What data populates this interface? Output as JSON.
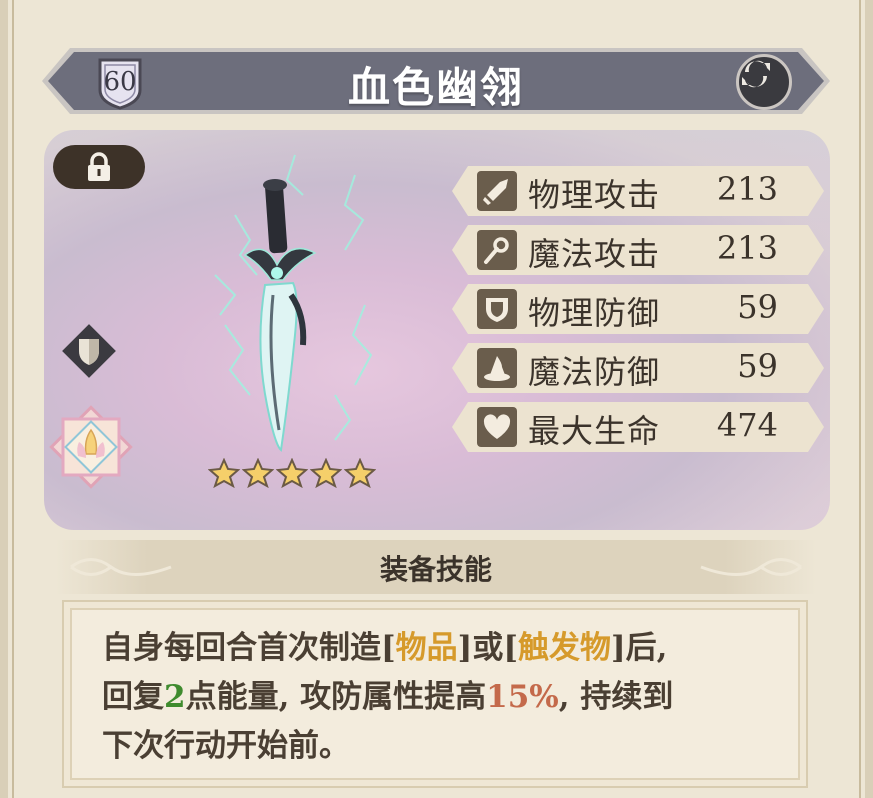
{
  "item": {
    "level": "60",
    "name": "血色幽翎",
    "stars": 5
  },
  "stats": [
    {
      "icon": "sword-icon",
      "label": "物理攻击",
      "value": "213"
    },
    {
      "icon": "staff-icon",
      "label": "魔法攻击",
      "value": "213"
    },
    {
      "icon": "shield-icon",
      "label": "物理防御",
      "value": "59"
    },
    {
      "icon": "wizard-hat-icon",
      "label": "魔法防御",
      "value": "59"
    },
    {
      "icon": "heart-icon",
      "label": "最大生命",
      "value": "474"
    }
  ],
  "skill": {
    "heading": "装备技能",
    "line1_a": "自身每回合首次制造[",
    "line1_b": "物品",
    "line1_c": "]或[",
    "line1_d": "触发物",
    "line1_e": "]后,",
    "line2_a": "回复",
    "line2_b": "2",
    "line2_c": "点能量, 攻防属性提高",
    "line2_d": "15%",
    "line2_e": ", 持续到",
    "line3": "下次行动开始前。"
  },
  "colors": {
    "banner": "#6f707e",
    "highlight_gold": "#d69a2b",
    "highlight_green": "#3f8b2e",
    "highlight_red": "#c46a4b"
  }
}
